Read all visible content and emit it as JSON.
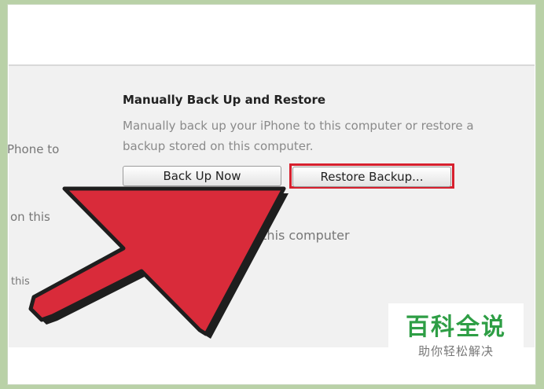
{
  "section": {
    "heading": "Manually Back Up and Restore",
    "description": "Manually back up your iPhone to this computer or restore a backup stored on this computer."
  },
  "buttons": {
    "back_up_now": "Back Up Now",
    "restore_backup": "Restore Backup..."
  },
  "partial_text": {
    "left_1": "Phone to",
    "left_2": "on this",
    "left_3": "this",
    "mid": "to this computer"
  },
  "highlight": {
    "color": "#d7202e"
  },
  "arrow": {
    "color": "#d92b3a",
    "icon": "pointer-arrow-icon"
  },
  "watermark": {
    "title": "百科全说",
    "subtitle": "助你轻松解决"
  }
}
